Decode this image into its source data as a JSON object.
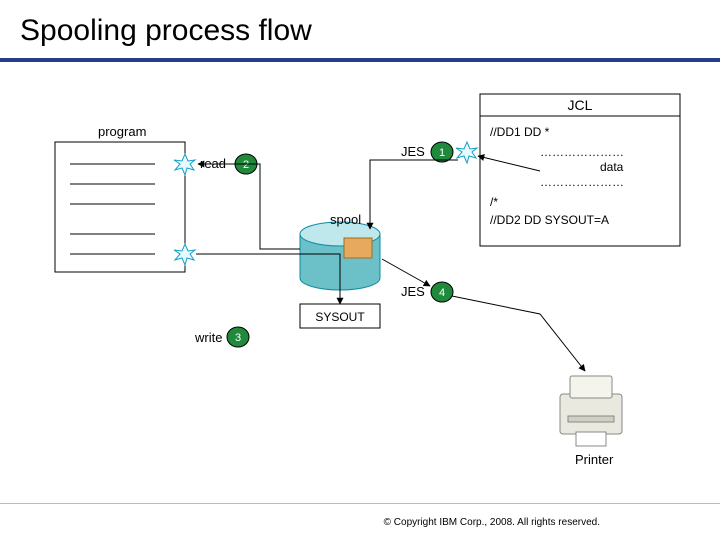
{
  "title": "Spooling process flow",
  "labels": {
    "program": "program",
    "read": "read",
    "spool": "spool",
    "sysout": "SYSOUT",
    "write": "write",
    "jes1": "JES",
    "jes4": "JES",
    "printer": "Printer"
  },
  "jcl": {
    "title": "JCL",
    "dd1": "//DD1   DD *",
    "dots1": "…………………",
    "data": "data",
    "dots2": "…………………",
    "end": "/*",
    "dd2": "//DD2   DD SYSOUT=A"
  },
  "steps": {
    "s1": "1",
    "s2": "2",
    "s3": "3",
    "s4": "4"
  },
  "footer": "© Copyright IBM Corp., 2008. All rights reserved."
}
